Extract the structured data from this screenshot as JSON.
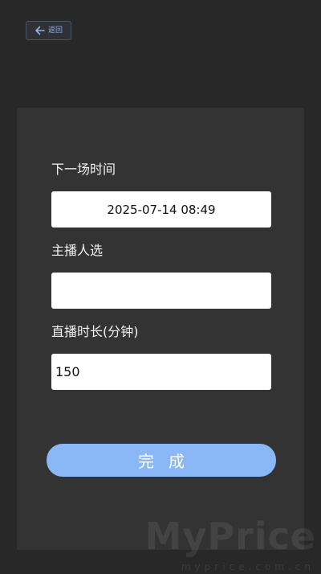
{
  "header": {
    "back_label": "返回",
    "back_icon": "arrow-left-icon",
    "accent_color": "#8fb2e6"
  },
  "form": {
    "next_time": {
      "label": "下一场时间",
      "value": "2025-07-14 08:49"
    },
    "host": {
      "label": "主播人选",
      "value": ""
    },
    "duration": {
      "label": "直播时长(分钟)",
      "value": "150"
    },
    "submit_label": "完成",
    "submit_color": "#8ab8f7"
  },
  "watermark": {
    "brand": "MyPrice",
    "domain": "myprice.com.cn"
  }
}
